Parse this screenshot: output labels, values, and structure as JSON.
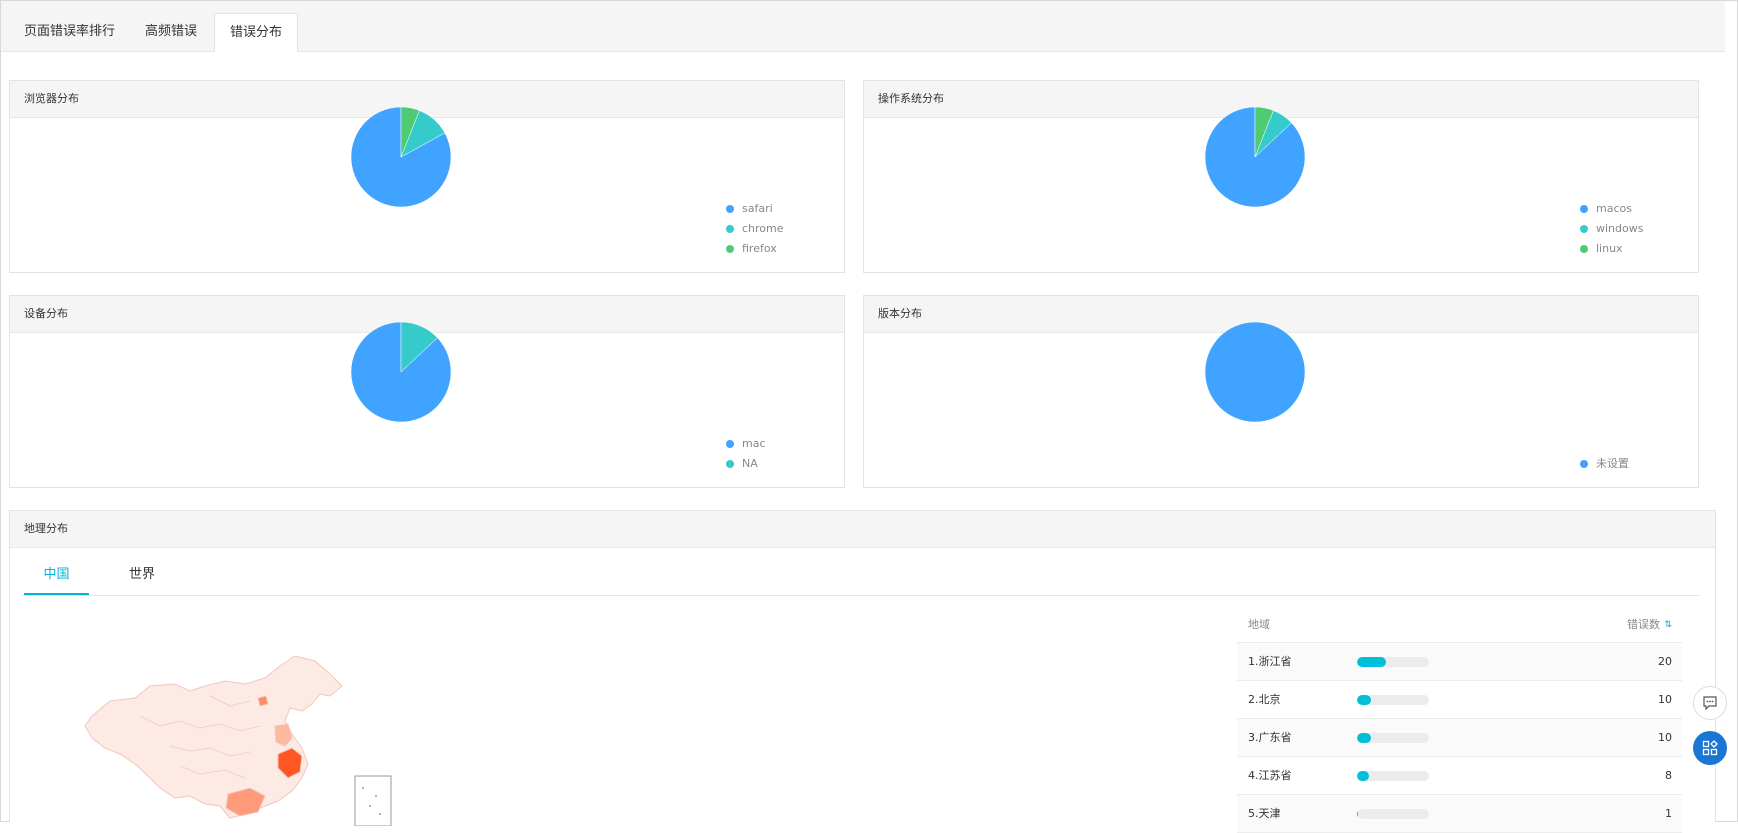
{
  "tabs": [
    {
      "label": "页面错误率排行",
      "active": false
    },
    {
      "label": "高频错误",
      "active": false
    },
    {
      "label": "错误分布",
      "active": true
    }
  ],
  "browser": {
    "title": "浏览器分布",
    "chart_data": {
      "type": "pie",
      "labels": [
        "safari",
        "chrome",
        "firefox"
      ],
      "values": [
        83,
        11,
        6
      ],
      "colors": [
        "#3fa3ff",
        "#36cbcb",
        "#4ecb73"
      ]
    }
  },
  "os": {
    "title": "操作系统分布",
    "chart_data": {
      "type": "pie",
      "labels": [
        "macos",
        "windows",
        "linux"
      ],
      "values": [
        87,
        7,
        6
      ],
      "colors": [
        "#3fa3ff",
        "#36cbcb",
        "#4ecb73"
      ]
    }
  },
  "device": {
    "title": "设备分布",
    "chart_data": {
      "type": "pie",
      "labels": [
        "mac",
        "NA"
      ],
      "values": [
        87,
        13
      ],
      "colors": [
        "#3fa3ff",
        "#36cbcb"
      ]
    }
  },
  "version": {
    "title": "版本分布",
    "chart_data": {
      "type": "pie",
      "labels": [
        "未设置"
      ],
      "values": [
        100
      ],
      "colors": [
        "#3fa3ff"
      ]
    }
  },
  "geo": {
    "title": "地理分布",
    "tabs": [
      {
        "label": "中国",
        "active": true
      },
      {
        "label": "世界",
        "active": false
      }
    ],
    "table": {
      "col_region": "地域",
      "col_count": "错误数",
      "max": 50,
      "rows": [
        {
          "label": "1.浙江省",
          "value": 20
        },
        {
          "label": "2.北京",
          "value": 10
        },
        {
          "label": "3.广东省",
          "value": 10
        },
        {
          "label": "4.江苏省",
          "value": 8
        },
        {
          "label": "5.天津",
          "value": 1
        }
      ]
    }
  },
  "icons": {
    "chat": "chat-icon",
    "apps": "apps-icon",
    "sort": "sort-icon"
  },
  "colors": {
    "accent": "#00b2d8",
    "pie_primary": "#3fa3ff",
    "float_primary": "#1976d2"
  }
}
